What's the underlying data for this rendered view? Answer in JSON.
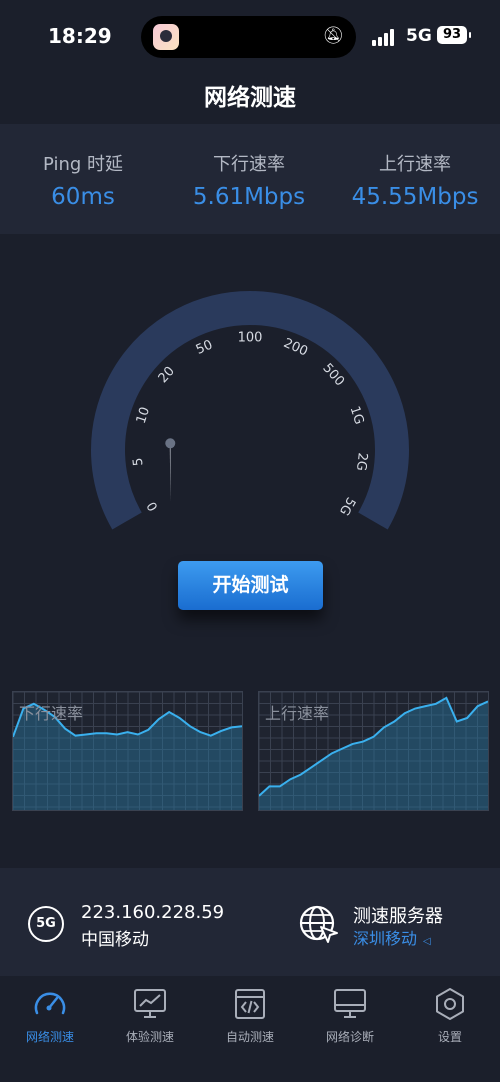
{
  "status_bar": {
    "time": "18:29",
    "network": "5G",
    "battery": "93",
    "mute_icon": "bell-slash-icon"
  },
  "header": {
    "title": "网络测速"
  },
  "stats": [
    {
      "label": "Ping 时延",
      "value": "60ms"
    },
    {
      "label": "下行速率",
      "value": "5.61Mbps"
    },
    {
      "label": "上行速率",
      "value": "45.55Mbps"
    }
  ],
  "gauge": {
    "ticks": [
      "0",
      "5",
      "10",
      "20",
      "50",
      "100",
      "200",
      "500",
      "1G",
      "2G",
      "5G"
    ],
    "needle_value": "5"
  },
  "start_button": {
    "label": "开始测试"
  },
  "charts": [
    {
      "label": "下行速率",
      "values": [
        0.62,
        0.86,
        0.9,
        0.85,
        0.79,
        0.69,
        0.63,
        0.64,
        0.65,
        0.65,
        0.64,
        0.66,
        0.64,
        0.68,
        0.77,
        0.83,
        0.78,
        0.71,
        0.66,
        0.63,
        0.67,
        0.7,
        0.71
      ]
    },
    {
      "label": "上行速率",
      "values": [
        0.12,
        0.2,
        0.2,
        0.26,
        0.3,
        0.36,
        0.42,
        0.48,
        0.52,
        0.56,
        0.58,
        0.62,
        0.7,
        0.75,
        0.82,
        0.86,
        0.88,
        0.9,
        0.95,
        0.75,
        0.78,
        0.88,
        0.92
      ]
    }
  ],
  "info": {
    "badge": "5G",
    "ip": "223.160.228.59",
    "carrier": "中国移动",
    "server_title": "测速服务器",
    "server_name": "深圳移动"
  },
  "tabs": [
    {
      "label": "网络测速",
      "icon": "speedometer-icon",
      "active": true
    },
    {
      "label": "体验测速",
      "icon": "monitor-chart-icon",
      "active": false
    },
    {
      "label": "自动测速",
      "icon": "code-icon",
      "active": false
    },
    {
      "label": "网络诊断",
      "icon": "monitor-icon",
      "active": false
    },
    {
      "label": "设置",
      "icon": "hexagon-gear-icon",
      "active": false
    }
  ],
  "colors": {
    "accent": "#3a8ee6",
    "background": "#1b1f2b",
    "panel": "#222736",
    "gauge_arc": "#2a3a5c"
  }
}
